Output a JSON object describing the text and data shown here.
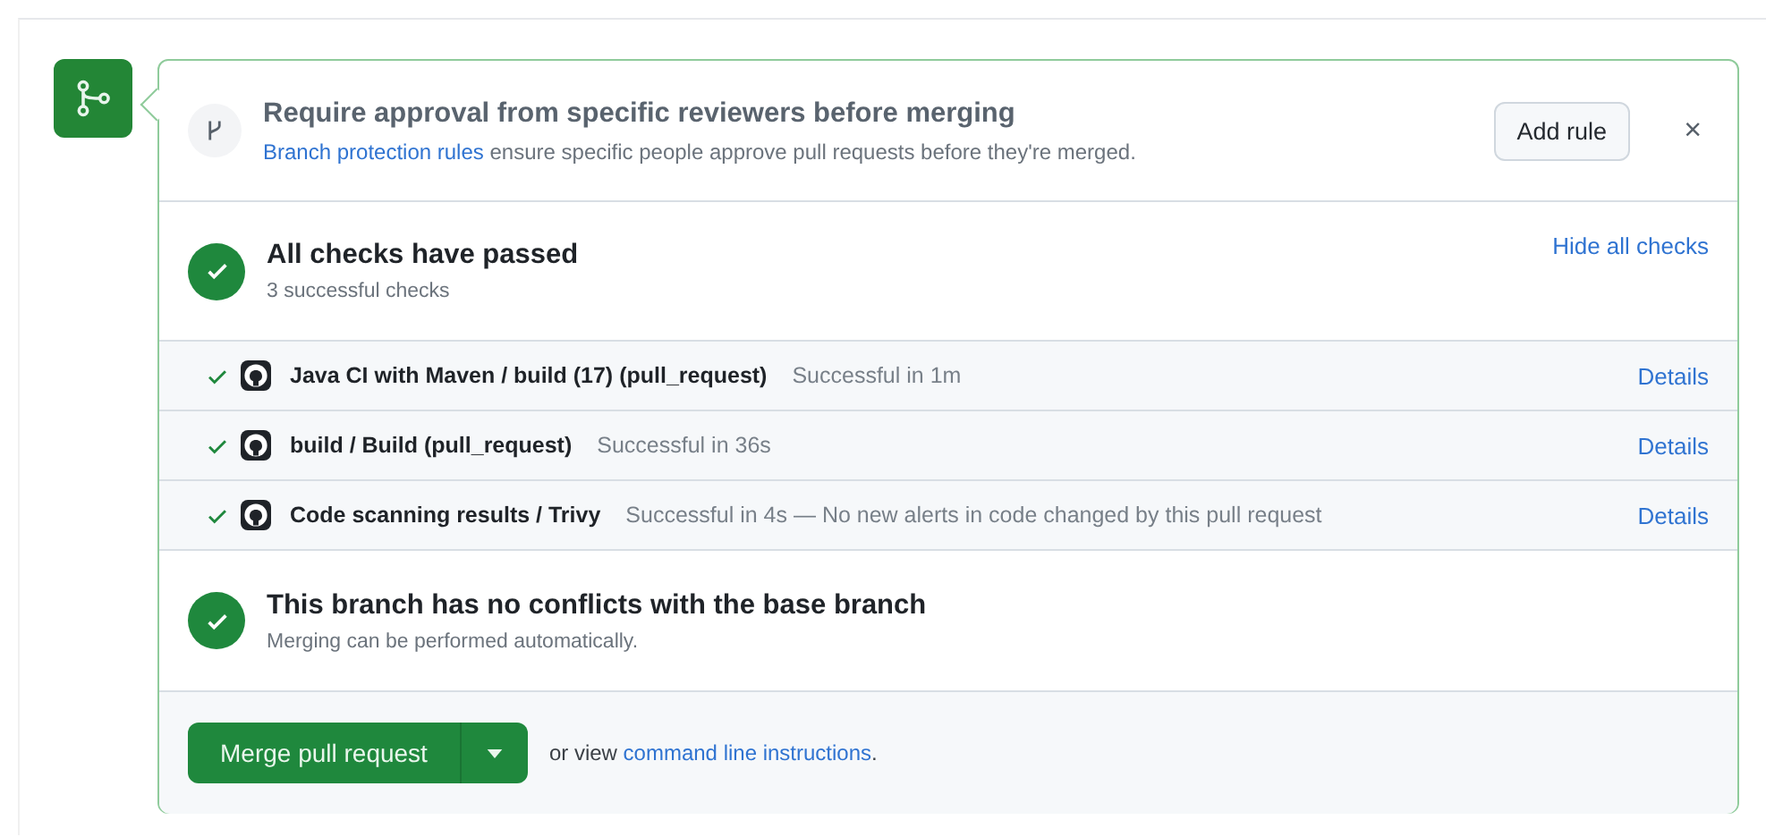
{
  "approval": {
    "title": "Require approval from specific reviewers before merging",
    "link": "Branch protection rules",
    "text": " ensure specific people approve pull requests before they're merged.",
    "button": "Add rule",
    "close": "×"
  },
  "checks_summary": {
    "title": "All checks have passed",
    "subtitle": "3 successful checks",
    "toggle": "Hide all checks"
  },
  "checks": [
    {
      "name": "Java CI with Maven / build (17) (pull_request)",
      "status": "Successful in 1m",
      "details": "Details"
    },
    {
      "name": "build / Build (pull_request)",
      "status": "Successful in 36s",
      "details": "Details"
    },
    {
      "name": "Code scanning results / Trivy",
      "status": "Successful in 4s — No new alerts in code changed by this pull request",
      "details": "Details"
    }
  ],
  "conflicts": {
    "title": "This branch has no conflicts with the base branch",
    "subtitle": "Merging can be performed automatically."
  },
  "merge": {
    "button": "Merge pull request",
    "prefix": "or view ",
    "link": "command line instructions",
    "suffix": "."
  }
}
